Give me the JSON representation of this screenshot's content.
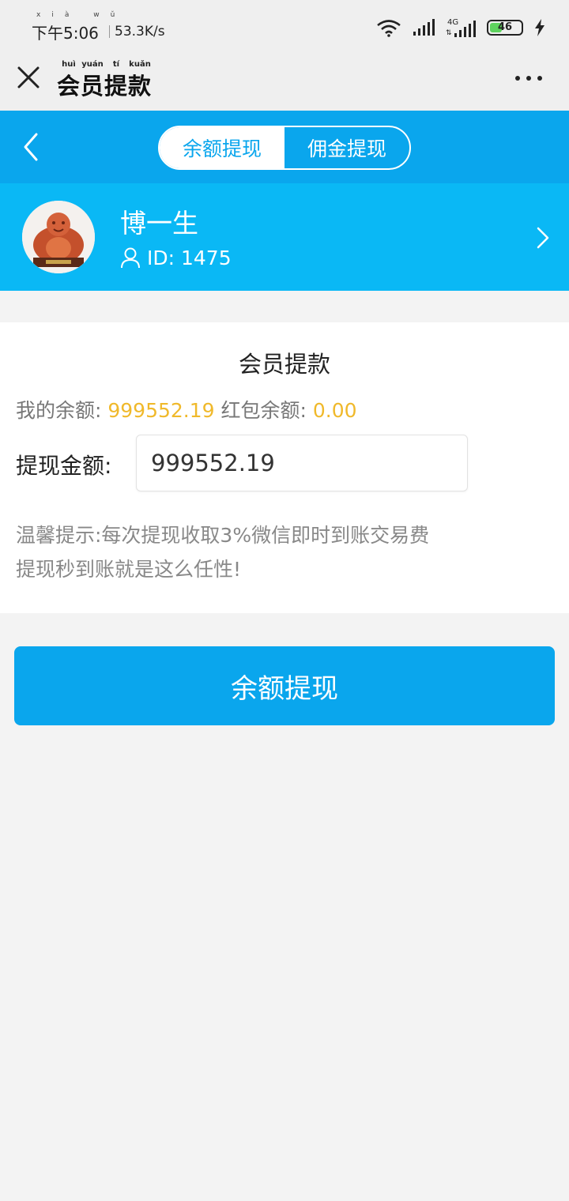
{
  "status_bar": {
    "time": "下午5:06",
    "time_ruby": "xià wǔ",
    "network_speed": "53.3K/s",
    "network_type": "4G",
    "battery_level": "46",
    "battery_percent": 46,
    "icons": [
      "wifi-icon",
      "signal-icon",
      "signal-4g-icon",
      "battery-icon",
      "charging-icon"
    ]
  },
  "nav": {
    "title": "会员提款",
    "title_ruby": [
      "huì",
      "yuán",
      "tí",
      "kuǎn"
    ],
    "close_icon": "close-icon",
    "more_icon": "more-icon"
  },
  "tabs": [
    {
      "label": "余额提现",
      "active": true
    },
    {
      "label": "佣金提现",
      "active": false
    }
  ],
  "profile": {
    "name": "博一生",
    "id_label": "ID: 1475"
  },
  "card": {
    "title": "会员提款",
    "balance_label": "我的余额: ",
    "balance_value": "999552.19",
    "redpacket_label": " 红包余额: ",
    "redpacket_value": "0.00",
    "amount_label": "提现金额:",
    "amount_value": "999552.19",
    "tip_line1": "温馨提示:每次提现收取3%微信即时到账交易费",
    "tip_line2": "提现秒到账就是这么任性!"
  },
  "submit_label": "余额提现",
  "colors": {
    "header_blue": "#0aa6ed",
    "profile_blue": "#0ab8f5",
    "amount_yellow": "#f0b92b",
    "page_bg": "#f3f3f3"
  }
}
